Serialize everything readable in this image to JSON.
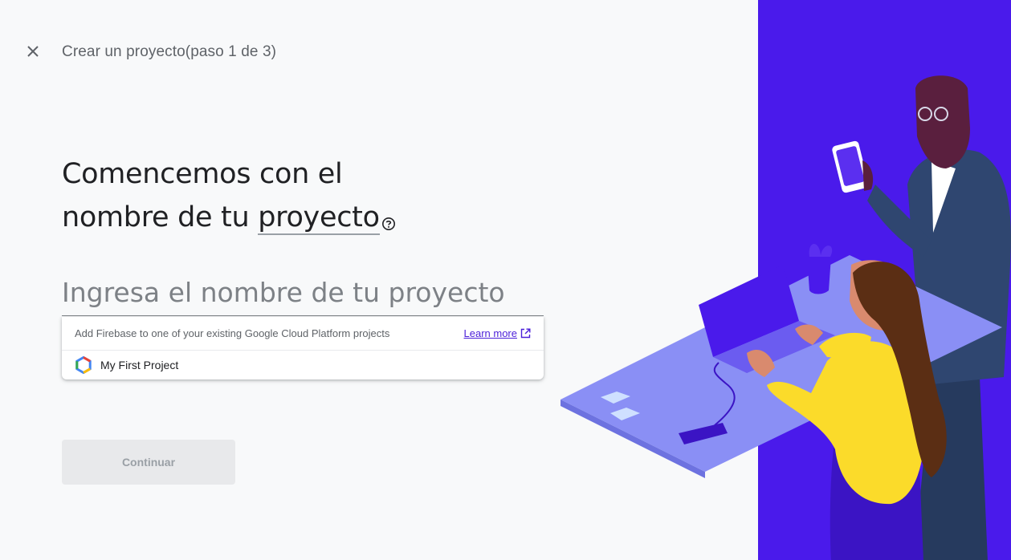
{
  "header": {
    "step_title": "Crear un proyecto(paso 1 de 3)"
  },
  "heading": {
    "line1": "Comencemos con el",
    "line2_prefix": "nombre de tu ",
    "line2_term": "proyecto"
  },
  "project_name": {
    "placeholder": "Ingresa el nombre de tu proyecto",
    "value": ""
  },
  "dropdown": {
    "hint": "Add Firebase to one of your existing Google Cloud Platform projects",
    "learn_more": "Learn more",
    "items": [
      {
        "label": "My First Project",
        "icon": "gcp-project-icon"
      }
    ]
  },
  "actions": {
    "continue_label": "Continuar",
    "continue_enabled": false
  },
  "colors": {
    "accent": "#4b1fd9",
    "illustration_bg": "#4a1aeb",
    "table": "#8a8ff5"
  }
}
